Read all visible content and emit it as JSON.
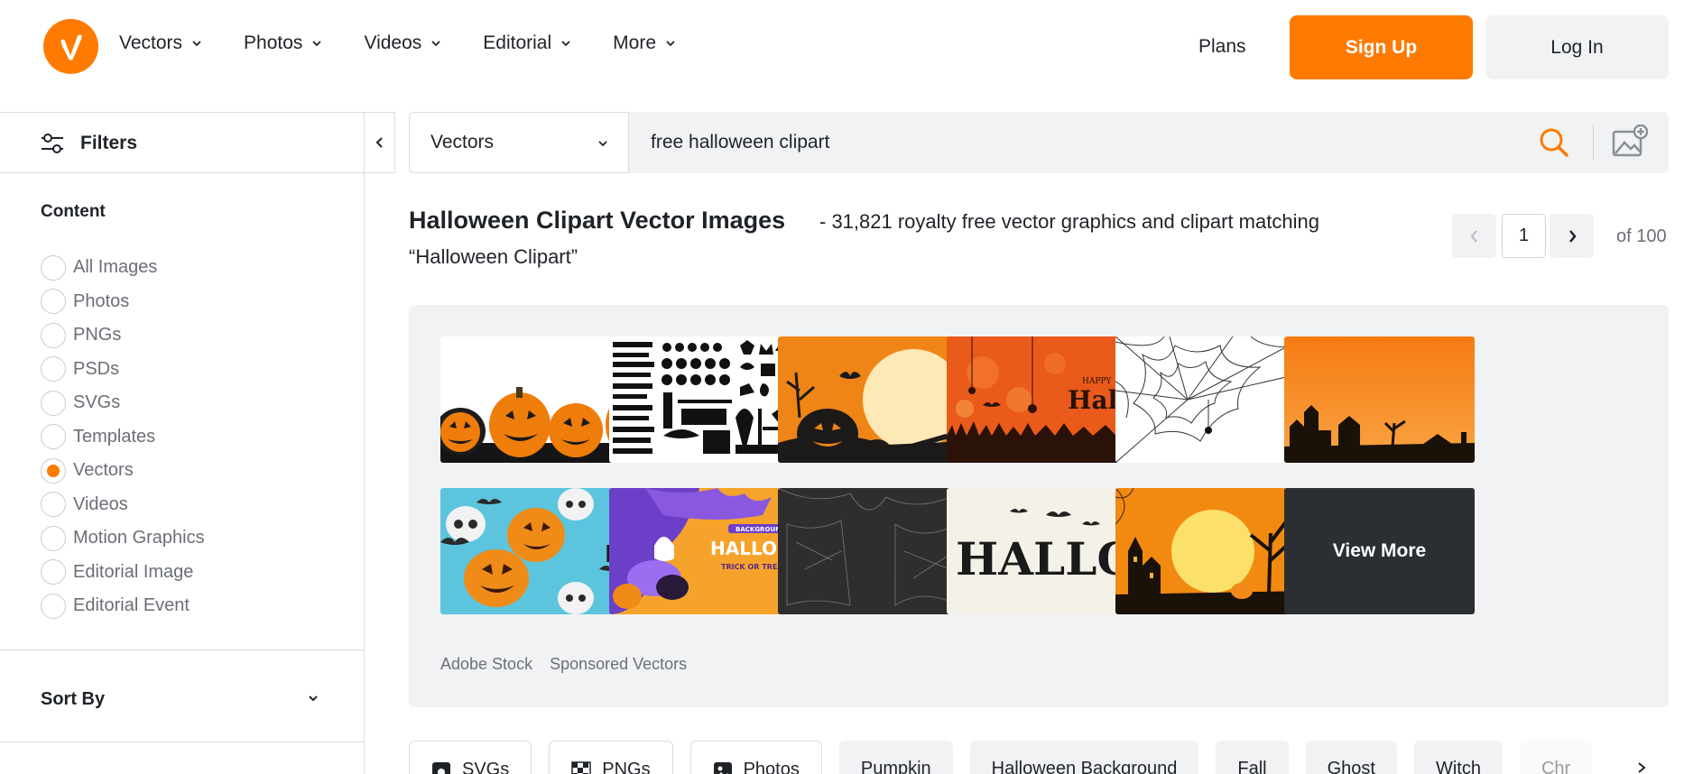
{
  "header": {
    "logo_icon": "vecteezy-logo-icon",
    "nav": [
      {
        "label": "Vectors"
      },
      {
        "label": "Photos"
      },
      {
        "label": "Videos"
      },
      {
        "label": "Editorial"
      },
      {
        "label": "More"
      }
    ],
    "plans_label": "Plans",
    "signup_label": "Sign Up",
    "login_label": "Log In"
  },
  "sidebar": {
    "filters_label": "Filters",
    "content_title": "Content",
    "content_options": [
      {
        "label": "All Images",
        "checked": false
      },
      {
        "label": "Photos",
        "checked": false
      },
      {
        "label": "PNGs",
        "checked": false
      },
      {
        "label": "PSDs",
        "checked": false
      },
      {
        "label": "SVGs",
        "checked": false
      },
      {
        "label": "Templates",
        "checked": false
      },
      {
        "label": "Vectors",
        "checked": true
      },
      {
        "label": "Videos",
        "checked": false
      },
      {
        "label": "Motion Graphics",
        "checked": false
      },
      {
        "label": "Editorial Image",
        "checked": false
      },
      {
        "label": "Editorial Event",
        "checked": false
      }
    ],
    "sort_by_label": "Sort By"
  },
  "search": {
    "category": "Vectors",
    "query": "free halloween clipart"
  },
  "results": {
    "title": "Halloween Clipart Vector Images",
    "subtitle": "- 31,821 royalty free vector graphics and clipart matching",
    "subtitle_line2": "“Halloween Clipart”",
    "page_current": "1",
    "page_of": "of 100"
  },
  "sponsored": {
    "view_more_label": "View More",
    "footer_source": "Adobe Stock",
    "footer_label": "Sponsored Vectors",
    "thumb_text": {
      "happy": "HAPPY",
      "halloween_script": "Hallowee",
      "ha": "HA",
      "halloween_banner": "HALLOWE",
      "background": "BACKGROUND",
      "trick_or_treat": "TRICK OR TREAT PA",
      "hallov": "HALLOV"
    }
  },
  "chips": [
    {
      "label": "SVGs",
      "icon": "svg-file-icon",
      "style": "outline"
    },
    {
      "label": "PNGs",
      "icon": "png-checker-icon",
      "style": "outline"
    },
    {
      "label": "Photos",
      "icon": "photo-icon",
      "style": "outline"
    },
    {
      "label": "Pumpkin",
      "style": "fill"
    },
    {
      "label": "Halloween Background",
      "style": "fill"
    },
    {
      "label": "Fall",
      "style": "fill"
    },
    {
      "label": "Ghost",
      "style": "fill"
    },
    {
      "label": "Witch",
      "style": "fill"
    },
    {
      "label": "Chr",
      "style": "fill"
    }
  ],
  "colors": {
    "accent": "#ff7a00",
    "panel_bg": "#f1f2f4",
    "muted_text": "#6b6f76"
  }
}
